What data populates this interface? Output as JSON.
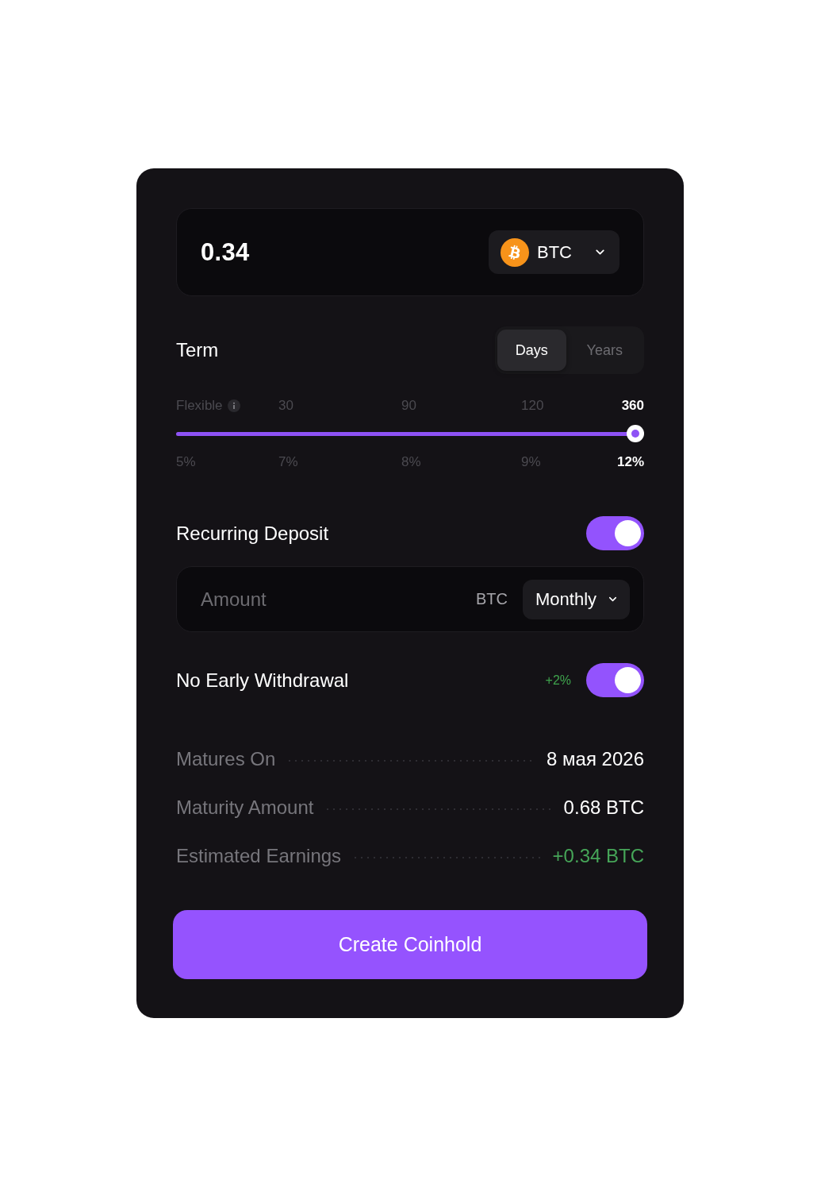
{
  "amount_input": {
    "value": "0.34",
    "currency": "BTC"
  },
  "term": {
    "title": "Term",
    "units": [
      {
        "label": "Days",
        "selected": true
      },
      {
        "label": "Years",
        "selected": false
      }
    ],
    "stops": [
      {
        "days": "Flexible",
        "rate": "5%",
        "info": true,
        "selected": false
      },
      {
        "days": "30",
        "rate": "7%",
        "info": false,
        "selected": false
      },
      {
        "days": "90",
        "rate": "8%",
        "info": false,
        "selected": false
      },
      {
        "days": "120",
        "rate": "9%",
        "info": false,
        "selected": false
      },
      {
        "days": "360",
        "rate": "12%",
        "info": false,
        "selected": true
      }
    ],
    "slider": {
      "level": 1
    }
  },
  "recurring_deposit": {
    "label": "Recurring Deposit",
    "on": true,
    "amount": {
      "placeholder": "Amount"
    },
    "currency": "BTC",
    "frequency": "Monthly"
  },
  "no_early_withdrawal": {
    "label": "No Early Withdrawal",
    "bonus": "+2%",
    "on": true
  },
  "summary": [
    {
      "label": "Matures On",
      "value": "8 мая 2026",
      "kind": "plain"
    },
    {
      "label": "Maturity Amount",
      "value": "0.68 BTC",
      "kind": "plain"
    },
    {
      "label": "Estimated Earnings",
      "value": "+0.34 BTC",
      "kind": "gain"
    }
  ],
  "submit": {
    "label": "Create Coinhold"
  }
}
